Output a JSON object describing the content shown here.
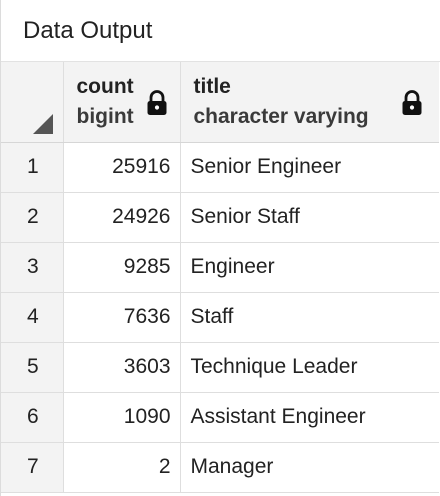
{
  "panel": {
    "title": "Data Output"
  },
  "columns": [
    {
      "name": "count",
      "type": "bigint",
      "locked": true,
      "lock_icon": "lock-icon"
    },
    {
      "name": "title",
      "type": "character varying",
      "locked": true,
      "lock_icon": "lock-icon"
    }
  ],
  "rows": [
    {
      "index": "1",
      "count": "25916",
      "title": "Senior Engineer"
    },
    {
      "index": "2",
      "count": "24926",
      "title": "Senior Staff"
    },
    {
      "index": "3",
      "count": "9285",
      "title": "Engineer"
    },
    {
      "index": "4",
      "count": "7636",
      "title": "Staff"
    },
    {
      "index": "5",
      "count": "3603",
      "title": "Technique Leader"
    },
    {
      "index": "6",
      "count": "1090",
      "title": "Assistant Engineer"
    },
    {
      "index": "7",
      "count": "2",
      "title": "Manager"
    }
  ],
  "colors": {
    "header_bg": "#f3f3f3",
    "grid_line": "#dedede",
    "text": "#222222"
  }
}
